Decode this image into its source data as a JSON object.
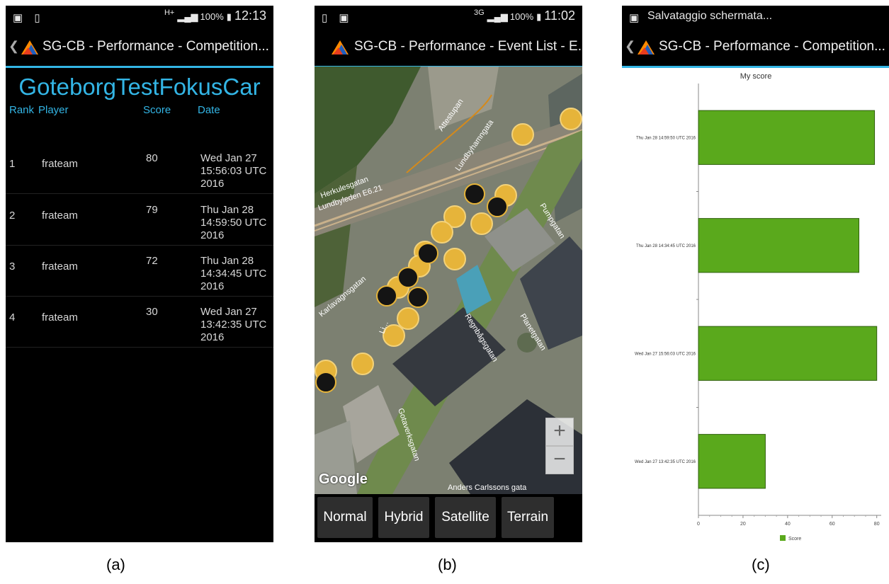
{
  "panel_a": {
    "status": {
      "left_icons": "▣ ▯",
      "net": "H+",
      "signal": "▂▄▆",
      "battery": "100%",
      "battery_icon": "▮",
      "time": "12:13"
    },
    "appbar": {
      "back": "❮",
      "title": "SG-CB - Performance - Competition..."
    },
    "competition_title": "GoteborgTestFokusCar",
    "headers": {
      "rank": "Rank",
      "player": "Player",
      "score": "Score",
      "date": "Date"
    },
    "rows": [
      {
        "rank": "1",
        "player": "frateam",
        "score": "80",
        "date": "Wed Jan 27 15:56:03 UTC 2016"
      },
      {
        "rank": "2",
        "player": "frateam",
        "score": "79",
        "date": "Thu Jan 28 14:59:50 UTC 2016"
      },
      {
        "rank": "3",
        "player": "frateam",
        "score": "72",
        "date": "Thu Jan 28 14:34:45 UTC 2016"
      },
      {
        "rank": "4",
        "player": "frateam",
        "score": "30",
        "date": "Wed Jan 27 13:42:35 UTC 2016"
      }
    ],
    "caption": "(a)"
  },
  "panel_b": {
    "status": {
      "left_icons": "▯ ▣",
      "net": "3G",
      "signal": "▂▄▆",
      "battery": "100%",
      "battery_icon": "▮",
      "time": "11:02"
    },
    "appbar": {
      "title": "SG-CB - Performance - Event List - E..."
    },
    "street_labels": [
      "Herkulesgatan",
      "Lundbyleden E6.21",
      "Lundbyhamngata",
      "Attestupan",
      "Karlavagnsgatan",
      "Regnbågsgatan",
      "Planetgatan",
      "Pumpgatan",
      "Anders Carlssons gata",
      "Gotaverksgatan",
      "Li..."
    ],
    "attribution": "Google",
    "zoom_in": "+",
    "zoom_out": "−",
    "buttons": [
      "Normal",
      "Hybrid",
      "Satellite",
      "Terrain"
    ],
    "caption": "(b)"
  },
  "panel_c": {
    "status": {
      "left_icon": "▣",
      "text": "Salvataggio schermata..."
    },
    "appbar": {
      "back": "❮",
      "title": "SG-CB - Performance - Competition..."
    },
    "caption": "(c)"
  },
  "chart_data": {
    "type": "bar",
    "orientation": "horizontal",
    "title": "My score",
    "categories": [
      "Thu Jan 28 14:59:50 UTC 2016",
      "Thu Jan 28 14:34:45 UTC 2016",
      "Wed Jan 27 15:56:03 UTC 2016",
      "Wed Jan 27 13:42:35 UTC 2016"
    ],
    "series": [
      {
        "name": "Score",
        "values": [
          79,
          72,
          80,
          30
        ],
        "color": "#5aa91c"
      }
    ],
    "xlim": [
      0,
      82
    ],
    "xticks": [
      0,
      20,
      40,
      60,
      80
    ],
    "legend": "bottom",
    "grid": false
  }
}
